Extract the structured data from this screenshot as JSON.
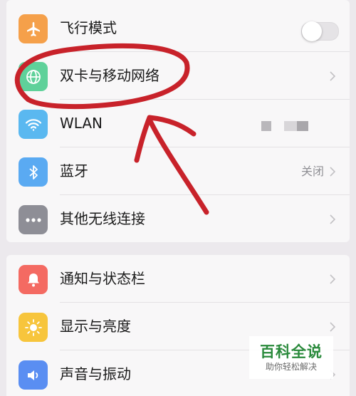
{
  "section1": {
    "airplane": {
      "label": "飞行模式",
      "toggle_on": false,
      "icon": "airplane-icon",
      "color": "#f5a04a"
    },
    "dualsim": {
      "label": "双卡与移动网络",
      "icon": "globe-icon",
      "color": "#5fd19a"
    },
    "wlan": {
      "label": "WLAN",
      "icon": "wifi-icon",
      "color": "#5ab8f0"
    },
    "bluetooth": {
      "label": "蓝牙",
      "value": "关闭",
      "icon": "bluetooth-icon",
      "color": "#5aaaf2"
    },
    "other": {
      "label": "其他无线连接",
      "icon": "more-icon",
      "color": "#8e8e96"
    }
  },
  "section2": {
    "notifications": {
      "label": "通知与状态栏",
      "icon": "bell-icon",
      "color": "#f46a62"
    },
    "display": {
      "label": "显示与亮度",
      "icon": "sun-icon",
      "color": "#f7c53c"
    },
    "sound": {
      "label": "声音与振动",
      "icon": "speaker-icon",
      "color": "#5a8ef2"
    }
  },
  "watermark": {
    "title": "百科全说",
    "subtitle": "助你轻松解决"
  },
  "annotation_color": "#c8222a"
}
